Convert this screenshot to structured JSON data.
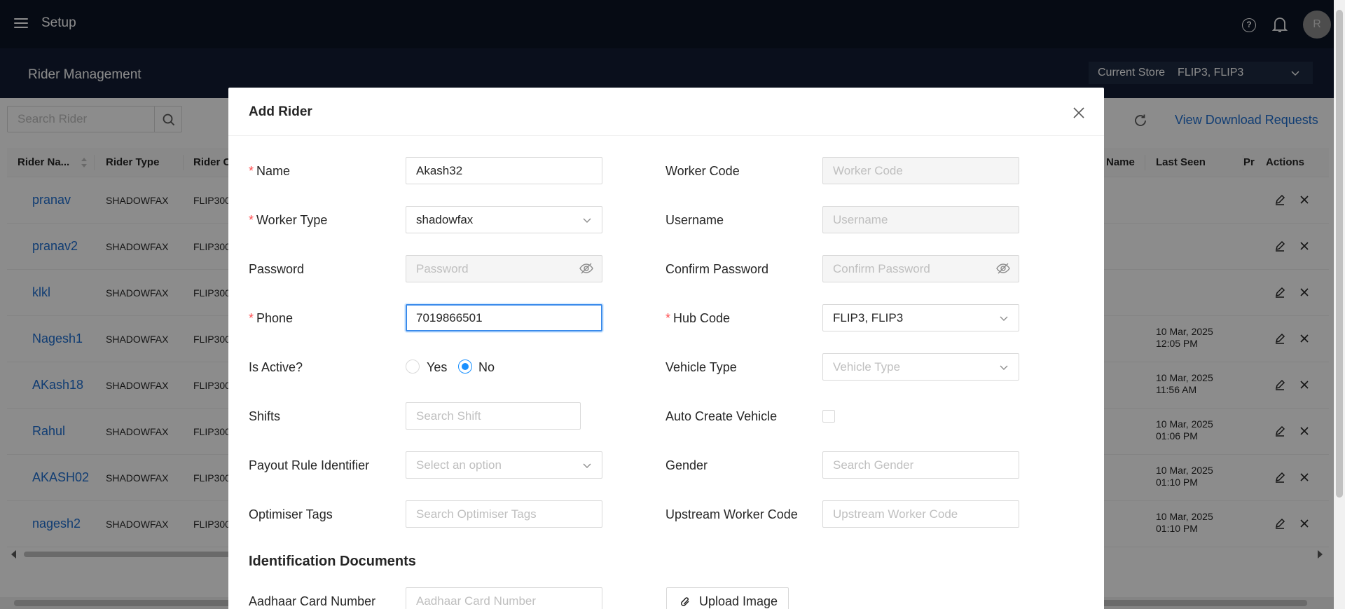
{
  "app": {
    "title": "Setup",
    "avatar_initial": "R"
  },
  "subheader": {
    "title": "Rider Management",
    "store_label": "Current Store",
    "store_value": "FLIP3, FLIP3"
  },
  "toolbar": {
    "search_placeholder": "Search Rider",
    "download_link": "View Download Requests"
  },
  "table": {
    "columns": [
      "Rider Na...",
      "Rider Type",
      "Rider C",
      "Name",
      "Last Seen",
      "Pr",
      "Actions"
    ],
    "rows": [
      {
        "name": "pranav",
        "type": "SHADOWFAX",
        "code": "FLIP300",
        "last_seen_date": "",
        "last_seen_time": ""
      },
      {
        "name": "pranav2",
        "type": "SHADOWFAX",
        "code": "FLIP300",
        "last_seen_date": "",
        "last_seen_time": ""
      },
      {
        "name": "klkl",
        "type": "SHADOWFAX",
        "code": "FLIP300",
        "last_seen_date": "",
        "last_seen_time": ""
      },
      {
        "name": "Nagesh1",
        "type": "SHADOWFAX",
        "code": "FLIP300",
        "last_seen_date": "10 Mar, 2025",
        "last_seen_time": "12:05 PM"
      },
      {
        "name": "AKash18",
        "type": "SHADOWFAX",
        "code": "FLIP300",
        "last_seen_date": "10 Mar, 2025",
        "last_seen_time": "11:56 AM"
      },
      {
        "name": "Rahul",
        "type": "SHADOWFAX",
        "code": "FLIP300",
        "last_seen_date": "10 Mar, 2025",
        "last_seen_time": "01:06 PM"
      },
      {
        "name": "AKASH02",
        "type": "SHADOWFAX",
        "code": "FLIP300",
        "last_seen_date": "10 Mar, 2025",
        "last_seen_time": "01:10 PM"
      },
      {
        "name": "nagesh2",
        "type": "SHADOWFAX",
        "code": "FLIP300",
        "last_seen_date": "10 Mar, 2025",
        "last_seen_time": "01:10 PM"
      }
    ]
  },
  "modal": {
    "title": "Add Rider",
    "fields": {
      "name": {
        "label": "Name",
        "value": "Akash32",
        "required": true
      },
      "worker_code": {
        "label": "Worker Code",
        "placeholder": "Worker Code"
      },
      "worker_type": {
        "label": "Worker Type",
        "value": "shadowfax",
        "required": true
      },
      "username": {
        "label": "Username",
        "placeholder": "Username"
      },
      "password": {
        "label": "Password",
        "placeholder": "Password"
      },
      "confirm_password": {
        "label": "Confirm Password",
        "placeholder": "Confirm Password"
      },
      "phone": {
        "label": "Phone",
        "value": "7019866501",
        "required": true
      },
      "hub_code": {
        "label": "Hub Code",
        "value": "FLIP3, FLIP3",
        "required": true
      },
      "is_active": {
        "label": "Is Active?",
        "options": [
          "Yes",
          "No"
        ],
        "selected": "No"
      },
      "vehicle_type": {
        "label": "Vehicle Type",
        "placeholder": "Vehicle Type"
      },
      "shifts": {
        "label": "Shifts",
        "placeholder": "Search Shift"
      },
      "auto_create_vehicle": {
        "label": "Auto Create Vehicle",
        "checked": false
      },
      "payout_rule": {
        "label": "Payout Rule Identifier",
        "placeholder": "Select an option"
      },
      "gender": {
        "label": "Gender",
        "placeholder": "Search Gender"
      },
      "optimiser_tags": {
        "label": "Optimiser Tags",
        "placeholder": "Search Optimiser Tags"
      },
      "upstream_worker_code": {
        "label": "Upstream Worker Code",
        "placeholder": "Upstream Worker Code"
      }
    },
    "section": "Identification Documents",
    "aadhaar": {
      "label": "Aadhaar Card Number",
      "placeholder": "Aadhaar Card Number"
    },
    "upload_label": "Upload Image"
  },
  "colors": {
    "header_bg": "#0b1426",
    "subheader_bg": "#131d33",
    "link": "#1f6fd1",
    "primary": "#1890ff",
    "required": "#ff4d4f"
  }
}
